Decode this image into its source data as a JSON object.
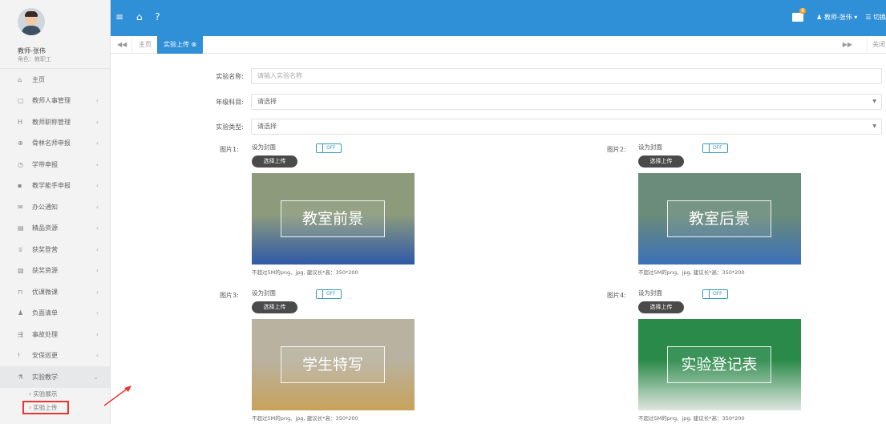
{
  "profile": {
    "name": "教师-张伟",
    "role": "角色：教职工"
  },
  "sidebar": {
    "items": [
      {
        "icon": "home-icon",
        "glyph": "⌂",
        "label": "主页",
        "chevron": false
      },
      {
        "icon": "clipboard-icon",
        "glyph": "▢",
        "label": "教师人事管理",
        "chevron": true
      },
      {
        "icon": "title-icon",
        "glyph": "H",
        "label": "教师职称管理",
        "chevron": true
      },
      {
        "icon": "award-icon",
        "glyph": "⊕",
        "label": "骨林名师申报",
        "chevron": true
      },
      {
        "icon": "clock-icon",
        "glyph": "◷",
        "label": "学带申报",
        "chevron": true
      },
      {
        "icon": "chart-icon",
        "glyph": "▪",
        "label": "教学能手申报",
        "chevron": true
      },
      {
        "icon": "mail-icon",
        "glyph": "✉",
        "label": "办公通知",
        "chevron": true
      },
      {
        "icon": "file-icon",
        "glyph": "▤",
        "label": "精品资源",
        "chevron": true
      },
      {
        "icon": "trophy-icon",
        "glyph": "♕",
        "label": "获奖登营",
        "chevron": true
      },
      {
        "icon": "doc-icon",
        "glyph": "▧",
        "label": "获奖资源",
        "chevron": true
      },
      {
        "icon": "bookmark-icon",
        "glyph": "⊓",
        "label": "优课微课",
        "chevron": true
      },
      {
        "icon": "user-list-icon",
        "glyph": "♟",
        "label": "负面清单",
        "chevron": true
      },
      {
        "icon": "process-icon",
        "glyph": "⇶",
        "label": "事故处理",
        "chevron": true
      },
      {
        "icon": "alert-icon",
        "glyph": "!",
        "label": "安保巡更",
        "chevron": true
      },
      {
        "icon": "flask-icon",
        "glyph": "⚗",
        "label": "实验教学",
        "chevron": true,
        "expanded": true
      }
    ],
    "sub_items": [
      "› 实验展示",
      "› 实验上传"
    ]
  },
  "topbar": {
    "left_icons": "≡ ⌂ ?",
    "mail_badge": "8",
    "user": "♟ 教师-张伟 ▾",
    "switch": "☰ 切换"
  },
  "tabs": {
    "prev": "◀◀",
    "home": "主页",
    "current": "实验上传 ⊗",
    "next": "▶▶",
    "close": "关闭"
  },
  "form": {
    "name_label": "实验名称:",
    "name_placeholder": "请输入实验名称",
    "grade_label": "年级科目:",
    "grade_value": "请选择",
    "type_label": "实验类型:",
    "type_value": "请选择",
    "caret": "▼"
  },
  "pictures": [
    {
      "label": "图片1:",
      "cover": "设为封面",
      "toggle": "OFF",
      "button": "选择上传",
      "caption": "教室前景",
      "hint": "不超过5M的png、jpg, 建议长*高：350*200",
      "colors": [
        "#8d9b7c",
        "#2f5aa8"
      ]
    },
    {
      "label": "图片2:",
      "cover": "设为封面",
      "toggle": "OFF",
      "button": "选择上传",
      "caption": "教室后景",
      "hint": "不超过5M的png、jpg, 建议长*高：350*200",
      "colors": [
        "#6b8c7a",
        "#3c70b8"
      ]
    },
    {
      "label": "图片3:",
      "cover": "设为封面",
      "toggle": "OFF",
      "button": "选择上传",
      "caption": "学生特写",
      "hint": "不超过5M的png、jpg, 建议长*高：350*200",
      "colors": [
        "#b9b2a0",
        "#c8a25a"
      ]
    },
    {
      "label": "图片4:",
      "cover": "设为封面",
      "toggle": "OFF",
      "button": "选择上传",
      "caption": "实验登记表",
      "hint": "不超过5M的png、jpg, 建议长*高：350*200",
      "colors": [
        "#2a8a4a",
        "#dfe6e0"
      ]
    }
  ]
}
